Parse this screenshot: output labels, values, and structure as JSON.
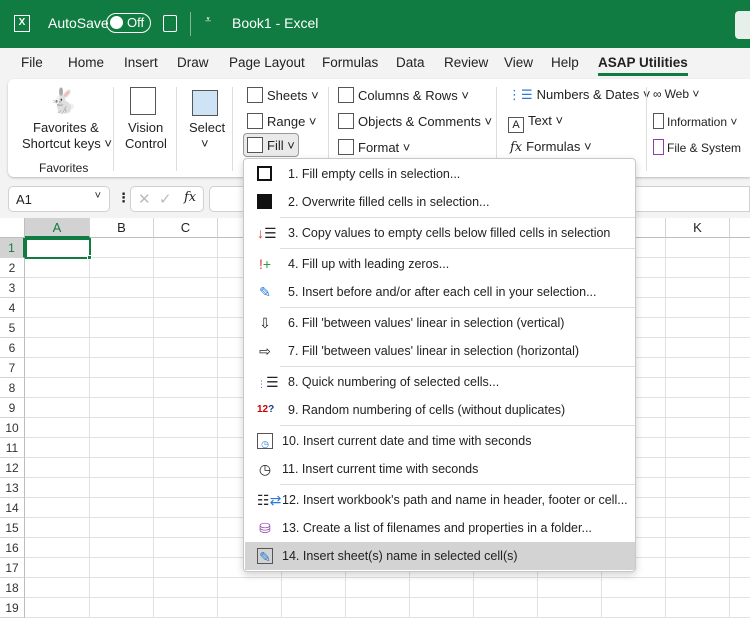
{
  "titlebar": {
    "autosave_label": "AutoSave",
    "autosave_state": "Off",
    "title": "Book1  -  Excel"
  },
  "tabs": [
    "File",
    "Home",
    "Insert",
    "Draw",
    "Page Layout",
    "Formulas",
    "Data",
    "Review",
    "View",
    "Help",
    "ASAP Utilities"
  ],
  "active_tab": "ASAP Utilities",
  "ribbon": {
    "favorites": "Favorites &",
    "shortcut": "Shortcut keys",
    "group_favorites": "Favorites",
    "vision1": "Vision",
    "vision2": "Control",
    "select": "Select",
    "sheets": "Sheets",
    "range": "Range",
    "fill": "Fill",
    "columns_rows": "Columns & Rows",
    "objects_comments": "Objects & Comments",
    "format": "Format",
    "numbers_dates": "Numbers & Dates",
    "text": "Text",
    "formulas": "Formulas",
    "web": "Web",
    "information": "Information",
    "file_system": "File & System"
  },
  "formula_bar": {
    "name_box": "A1",
    "fx": "fx"
  },
  "columns": [
    "A",
    "B",
    "C",
    "K"
  ],
  "rows": [
    "1",
    "2",
    "3",
    "4",
    "5",
    "6",
    "7",
    "8",
    "9",
    "10",
    "11",
    "12",
    "13",
    "14",
    "15",
    "16",
    "17",
    "18",
    "19"
  ],
  "menu": [
    "1. Fill empty cells in selection...",
    "2. Overwrite filled cells in selection...",
    "3. Copy values to empty cells below filled cells in selection",
    "4. Fill up with leading zeros...",
    "5. Insert before and/or after each cell in your selection...",
    "6. Fill 'between values' linear in selection (vertical)",
    "7. Fill 'between values' linear in selection (horizontal)",
    "8. Quick numbering of selected cells...",
    "9. Random numbering of cells (without duplicates)",
    "10. Insert current date and time with seconds",
    "11. Insert current time with seconds",
    "12. Insert workbook's path and name in header, footer or cell...",
    "13. Create a list of filenames and properties in a folder...",
    "14. Insert sheet(s) name in selected cell(s)"
  ],
  "highlighted_item": "14. Insert sheet(s) name in selected cell(s)",
  "colors": {
    "brand": "#107c41",
    "highlight": "#d3d3d3"
  }
}
